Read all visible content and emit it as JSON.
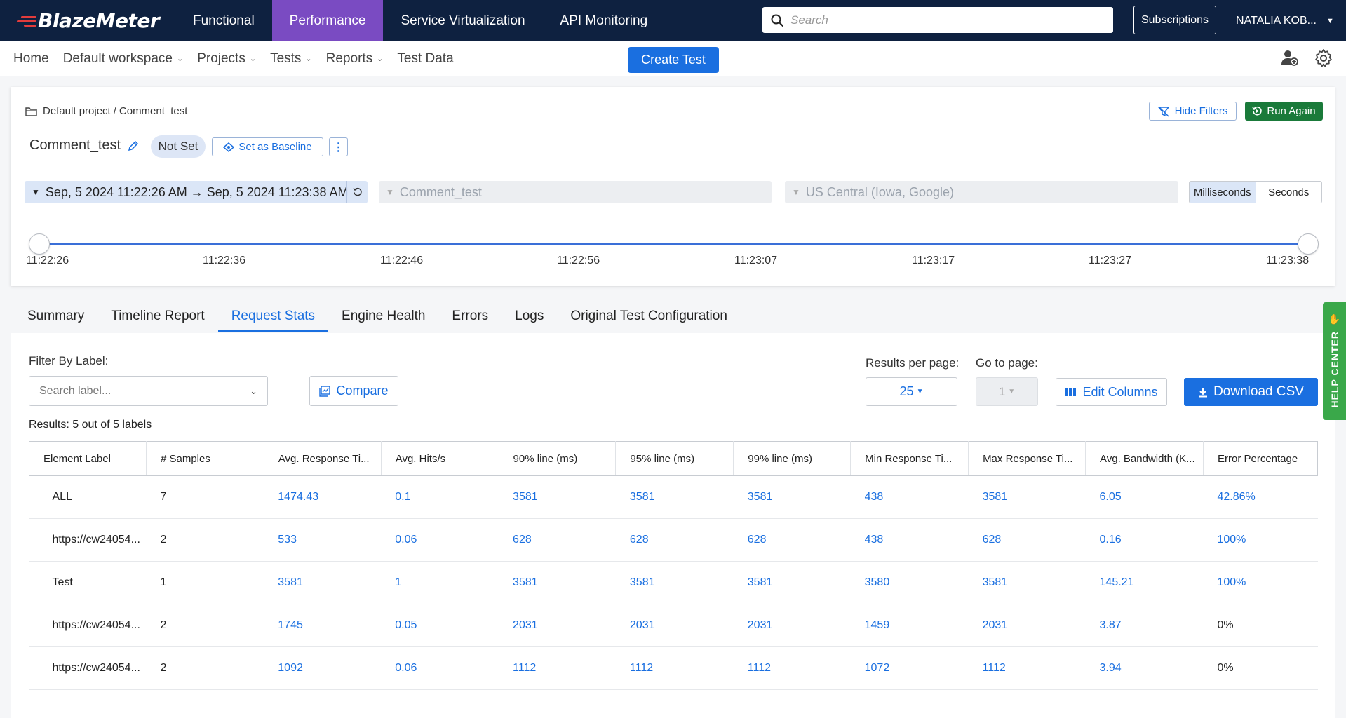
{
  "brand": {
    "name": "BlazeMeter"
  },
  "topnav": {
    "items": [
      {
        "label": "Functional"
      },
      {
        "label": "Performance"
      },
      {
        "label": "Service Virtualization"
      },
      {
        "label": "API Monitoring"
      }
    ],
    "active_index": 1
  },
  "search": {
    "placeholder": "Search"
  },
  "subscriptions_label": "Subscriptions",
  "user_name": "NATALIA KOB...",
  "subnav": {
    "home": "Home",
    "workspace": "Default workspace",
    "projects": "Projects",
    "tests": "Tests",
    "reports": "Reports",
    "test_data": "Test Data",
    "create_test": "Create Test"
  },
  "report": {
    "breadcrumb_project": "Default project",
    "breadcrumb_sep": "/",
    "breadcrumb_test": "Comment_test",
    "hide_filters": "Hide Filters",
    "run_again": "Run Again",
    "test_name": "Comment_test",
    "status": "Not Set",
    "set_baseline": "Set as Baseline",
    "date_range": "Sep, 5 2024 11:22:26 AM → Sep, 5 2024 11:23:38 AM",
    "scenario_filter": "Comment_test",
    "location_filter": "US Central (Iowa, Google)",
    "unit_ms": "Milliseconds",
    "unit_s": "Seconds",
    "timeline_ticks": [
      "11:22:26",
      "11:22:36",
      "11:22:46",
      "11:22:56",
      "11:23:07",
      "11:23:17",
      "11:23:27",
      "11:23:38"
    ]
  },
  "tabs": [
    {
      "label": "Summary"
    },
    {
      "label": "Timeline Report"
    },
    {
      "label": "Request Stats"
    },
    {
      "label": "Engine Health"
    },
    {
      "label": "Errors"
    },
    {
      "label": "Logs"
    },
    {
      "label": "Original Test Configuration"
    }
  ],
  "active_tab": 2,
  "request_stats": {
    "filter_label": "Filter By Label:",
    "search_placeholder": "Search label...",
    "compare": "Compare",
    "results_per_page_label": "Results per page:",
    "results_per_page": "25",
    "go_to_page_label": "Go to page:",
    "go_to_page": "1",
    "edit_columns": "Edit Columns",
    "download_csv": "Download CSV",
    "results_text": "Results: 5 out of 5 labels",
    "columns": [
      "Element Label",
      "# Samples",
      "Avg. Response Ti...",
      "Avg. Hits/s",
      "90% line (ms)",
      "95% line (ms)",
      "99% line (ms)",
      "Min Response Ti...",
      "Max Response Ti...",
      "Avg. Bandwidth (K...",
      "Error Percentage"
    ],
    "rows": [
      [
        "ALL",
        "7",
        "1474.43",
        "0.1",
        "3581",
        "3581",
        "3581",
        "438",
        "3581",
        "6.05",
        "42.86%"
      ],
      [
        "https://cw24054...",
        "2",
        "533",
        "0.06",
        "628",
        "628",
        "628",
        "438",
        "628",
        "0.16",
        "100%"
      ],
      [
        "Test",
        "1",
        "3581",
        "1",
        "3581",
        "3581",
        "3581",
        "3580",
        "3581",
        "145.21",
        "100%"
      ],
      [
        "https://cw24054...",
        "2",
        "1745",
        "0.05",
        "2031",
        "2031",
        "2031",
        "1459",
        "2031",
        "3.87",
        "0%"
      ],
      [
        "https://cw24054...",
        "2",
        "1092",
        "0.06",
        "1112",
        "1112",
        "1112",
        "1072",
        "1112",
        "3.94",
        "0%"
      ]
    ]
  },
  "help_center": "HELP CENTER",
  "colors": {
    "navy": "#0e2140",
    "purple": "#7a4bc2",
    "blue": "#1a6fe0",
    "green": "#1a7a3a",
    "help_green": "#3aa84a"
  }
}
